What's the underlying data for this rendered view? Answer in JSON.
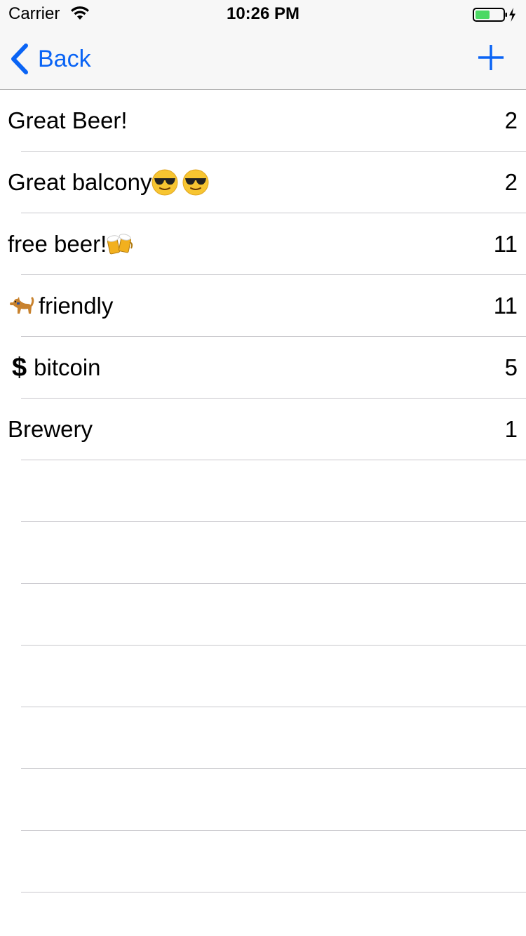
{
  "status_bar": {
    "carrier": "Carrier",
    "time": "10:26 PM",
    "wifi_icon": "wifi-icon",
    "battery_icon": "battery-charging-icon",
    "battery_color": "#4cd964"
  },
  "nav_bar": {
    "back_label": "Back",
    "back_icon": "chevron-left-icon",
    "add_icon": "plus-icon",
    "tint_color": "#0a64f5"
  },
  "rows": [
    {
      "label": "Great Beer!",
      "count": "2"
    },
    {
      "label": "Great balcony",
      "suffix_icons": [
        "sunglasses-face-emoji",
        "sunglasses-face-emoji"
      ],
      "count": "2"
    },
    {
      "label": "free beer!",
      "suffix_icons": [
        "beer-mugs-emoji"
      ],
      "count": "11"
    },
    {
      "prefix_icons": [
        "dog-emoji"
      ],
      "label": "friendly",
      "count": "11"
    },
    {
      "prefix_text": "$",
      "label": "bitcoin",
      "count": "5"
    },
    {
      "label": "Brewery",
      "count": "1"
    }
  ]
}
